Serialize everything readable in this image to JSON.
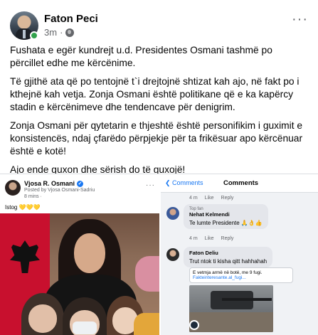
{
  "post": {
    "author": "Faton Peci",
    "time": "3m",
    "dot": "·",
    "more": "···",
    "paragraphs": [
      "Fushata e egër kundrejt u.d. Presidentes Osmani tashmë po përcillet edhe me kërcënime.",
      "Të gjithë ata që po tentojnë t`i drejtojnë shtizat kah ajo, në fakt po i kthejnë kah vetja. Zonja Osmani është politikane që e ka kapërcy stadin e kërcënimeve dhe tendencave për denigrim.",
      "Zonja Osmani për qytetarin e thjeshtë është personifikim i guximit e konsistencës, ndaj çfarëdo përpjekje për ta frikësuar apo kërcënuar është e kotë!",
      "Ajo ende guxon dhe sërish do të guxojë!"
    ]
  },
  "shared": {
    "name": "Vjosa R. Osmani",
    "verified_mark": "✓",
    "posted_by": "Posted by Vjosa Osmani-Sadriu",
    "time": "8 mins ·",
    "more": "···",
    "caption": "Istog 💛💛💛"
  },
  "comments": {
    "back": "❮ Comments",
    "title": "Comments",
    "row1": [
      "4 m",
      "Like",
      "Reply"
    ],
    "c1": {
      "badge": "Top fan",
      "name": "Nehat Kelmendi",
      "text": "Te lumte Presidente 🙏👌👍",
      "actions": [
        "4 m",
        "Like",
        "Reply"
      ]
    },
    "c2": {
      "name": "Faton Deliu",
      "text": "Trut ntok ti kisha qitt hahhahah",
      "link_title": "E vetmja armë në botë, me 9 fugi.",
      "link_url": "Fakteinteresante.al_fugi..."
    }
  },
  "colors": {
    "accent": "#1877f2",
    "online": "#31a24c",
    "flag_red": "#c8102e"
  }
}
